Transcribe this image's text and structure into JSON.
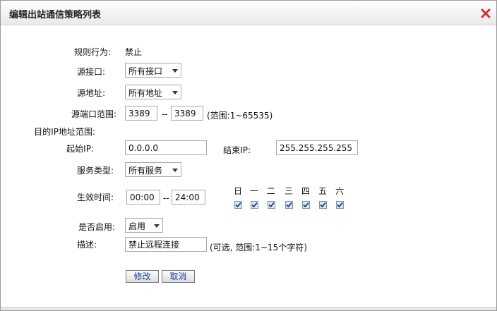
{
  "dialog": {
    "title": "编辑出站通信策略列表"
  },
  "form": {
    "rule_action_label": "规则行为:",
    "rule_action_value": "禁止",
    "src_iface_label": "源接口:",
    "src_iface_value": "所有接口",
    "src_addr_label": "源地址:",
    "src_addr_value": "所有地址",
    "src_port_label": "源端口范围:",
    "src_port_start": "3389",
    "src_port_sep": "--",
    "src_port_end": "3389",
    "src_port_hint": "(范围:1~65535)",
    "dst_range_label": "目的IP地址范围:",
    "start_ip_label": "起始IP:",
    "start_ip_value": "0.0.0.0",
    "end_ip_label": "结束IP:",
    "end_ip_value": "255.255.255.255",
    "service_label": "服务类型:",
    "service_value": "所有服务",
    "time_label": "生效时间:",
    "time_start": "00:00",
    "time_sep": "--",
    "time_end": "24:00",
    "days": [
      {
        "label": "日",
        "checked": true
      },
      {
        "label": "一",
        "checked": true
      },
      {
        "label": "二",
        "checked": true
      },
      {
        "label": "三",
        "checked": true
      },
      {
        "label": "四",
        "checked": true
      },
      {
        "label": "五",
        "checked": true
      },
      {
        "label": "六",
        "checked": true
      }
    ],
    "enabled_label": "是否启用:",
    "enabled_value": "启用",
    "desc_label": "描述:",
    "desc_value": "禁止远程连接",
    "desc_hint": "(可选, 范围:1~15个字符)"
  },
  "buttons": {
    "modify": "修改",
    "cancel": "取消"
  },
  "colors": {
    "close_icon": "#d63030",
    "button_text": "#1a3ea0",
    "checkbox_fill": "#dbe6f5"
  }
}
